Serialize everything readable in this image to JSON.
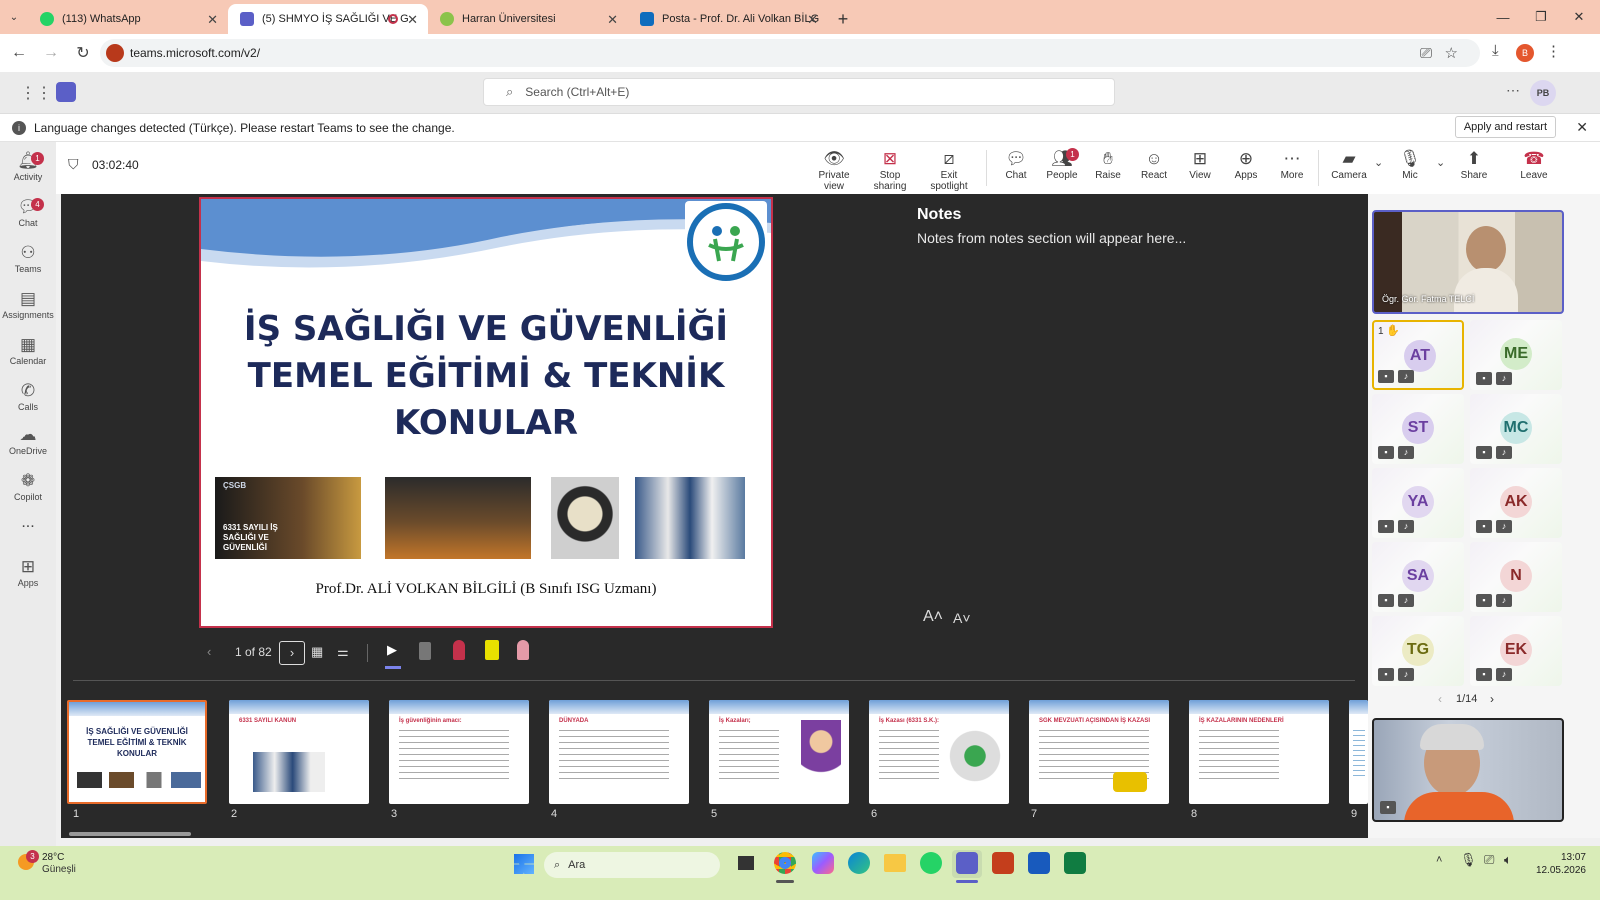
{
  "browser": {
    "tabs": [
      {
        "title": "(113) WhatsApp",
        "color": "#25d366"
      },
      {
        "title": "(5) SHMYO İŞ SAĞLIĞI VE G",
        "color": "#5b5fc7"
      },
      {
        "title": "Harran Üniversitesi",
        "color": "#8bc34a"
      },
      {
        "title": "Posta - Prof. Dr. Ali Volkan BİLG",
        "color": "#0f6cbd"
      }
    ],
    "url": "teams.microsoft.com/v2/",
    "profile_initial": "B"
  },
  "teams": {
    "search_placeholder": "Search (Ctrl+Alt+E)",
    "user_initials": "PB",
    "notice": "Language changes detected (Türkçe). Please restart Teams to see the change.",
    "apply_label": "Apply and restart"
  },
  "rail": [
    {
      "label": "Activity",
      "badge": "1"
    },
    {
      "label": "Chat",
      "badge": "4"
    },
    {
      "label": "Teams",
      "badge": ""
    },
    {
      "label": "Assignments",
      "badge": ""
    },
    {
      "label": "Calendar",
      "badge": ""
    },
    {
      "label": "Calls",
      "badge": ""
    },
    {
      "label": "OneDrive",
      "badge": ""
    },
    {
      "label": "Copilot",
      "badge": ""
    },
    {
      "label": "...",
      "badge": ""
    },
    {
      "label": "Apps",
      "badge": ""
    }
  ],
  "meeting": {
    "timer": "03:02:40",
    "toolbar": {
      "private_view": "Private view",
      "stop_sharing": "Stop sharing",
      "exit_spotlight": "Exit spotlight",
      "chat": "Chat",
      "people": "People",
      "people_badge": "1",
      "raise": "Raise",
      "react": "React",
      "view": "View",
      "apps": "Apps",
      "more": "More",
      "camera": "Camera",
      "mic": "Mic",
      "share": "Share",
      "leave": "Leave"
    }
  },
  "slide": {
    "title_lines": [
      "İŞ SAĞLIĞI VE GÜVENLİĞİ",
      "TEMEL EĞİTİMİ & TEKNİK",
      "KONULAR"
    ],
    "photo1_text": "6331 SAYILI İŞ SAĞLIĞI VE GÜVENLİĞİ",
    "photo1_logo": "ÇSGB",
    "author": "Prof.Dr. ALİ VOLKAN BİLGİLİ (B Sınıfı ISG Uzmanı)",
    "page": "1 of 82"
  },
  "notes": {
    "heading": "Notes",
    "body": "Notes from notes section will appear here..."
  },
  "thumbnails": [
    {
      "num": "1",
      "title": "İŞ SAĞLIĞI VE GÜVENLİĞİ TEMEL EĞİTİMİ & TEKNİK KONULAR"
    },
    {
      "num": "2",
      "title": "6331 SAYILI KANUN"
    },
    {
      "num": "3",
      "title": "İş güvenliğinin amacı:"
    },
    {
      "num": "4",
      "title": "DÜNYADA"
    },
    {
      "num": "5",
      "title": "İş Kazaları;"
    },
    {
      "num": "6",
      "title": "İş Kazası (6331 S.K.):"
    },
    {
      "num": "7",
      "title": "SGK MEVZUATI AÇISINDAN İŞ KAZASI"
    },
    {
      "num": "8",
      "title": "İŞ KAZALARININ NEDENLERİ"
    },
    {
      "num": "9",
      "title": ""
    }
  ],
  "participants": {
    "presenter_name": "Ögr. Gör. Fatma TELCİ",
    "hand_count": "1",
    "tiles": [
      {
        "initials": "AT",
        "color": "#6b3fa0",
        "bg": "#d8cdee"
      },
      {
        "initials": "ME",
        "color": "#3a6b2a",
        "bg": "#d3ecc9"
      },
      {
        "initials": "ST",
        "color": "#6b3fa0",
        "bg": "#d8cdee"
      },
      {
        "initials": "MC",
        "color": "#1f6f6f",
        "bg": "#c7e7e5"
      },
      {
        "initials": "YA",
        "color": "#6b3fa0",
        "bg": "#e1d7f0"
      },
      {
        "initials": "AK",
        "color": "#8a2a2a",
        "bg": "#f3d6d6"
      },
      {
        "initials": "SA",
        "color": "#6b3fa0",
        "bg": "#e1d7f0"
      },
      {
        "initials": "N",
        "color": "#8a2a2a",
        "bg": "#f3d6d6"
      },
      {
        "initials": "TG",
        "color": "#6b6b10",
        "bg": "#ecebc4"
      },
      {
        "initials": "EK",
        "color": "#8a2a2a",
        "bg": "#f3d6d6"
      }
    ],
    "pager": "1/14"
  },
  "taskbar": {
    "weather_temp": "28°C",
    "weather_text": "Güneşli",
    "weather_badge": "3",
    "search": "Ara",
    "time": "13:07",
    "date": "12.05.2026"
  }
}
